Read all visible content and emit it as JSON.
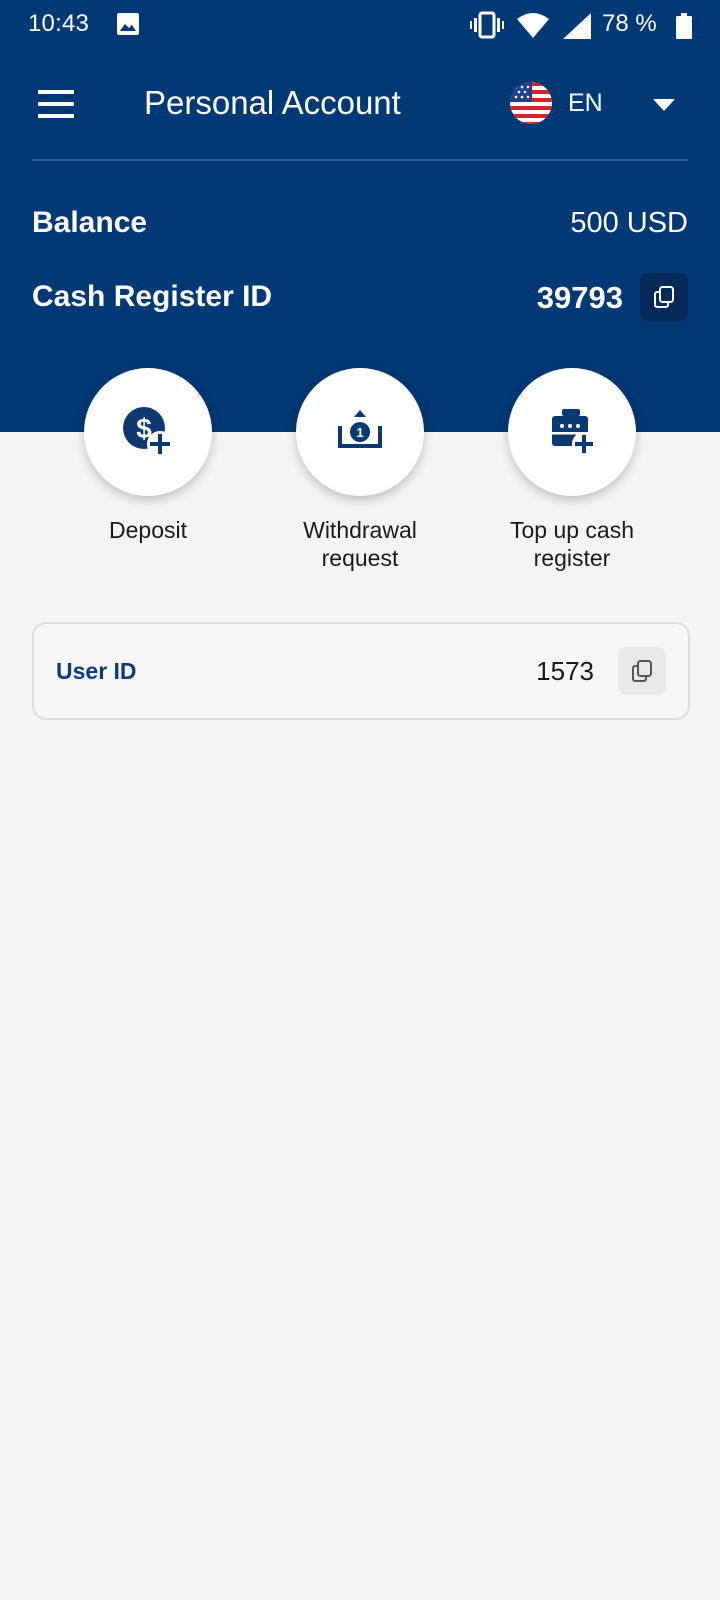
{
  "status_bar": {
    "time": "10:43",
    "battery": "78 %",
    "icons": [
      "gallery-icon",
      "vibrate-icon",
      "wifi-icon",
      "signal-icon",
      "battery-icon"
    ]
  },
  "app_bar": {
    "title": "Personal Account",
    "menu_icon": "hamburger-menu-icon",
    "language": {
      "code": "EN",
      "flag_icon": "us-flag-icon",
      "dropdown_icon": "chevron-down-icon"
    }
  },
  "account": {
    "balance_label": "Balance",
    "balance_value": "500 USD",
    "cash_register_label": "Cash Register ID",
    "cash_register_value": "39793",
    "copy_icon": "copy-icon"
  },
  "actions": [
    {
      "label": "Deposit",
      "icon": "dollar-plus-icon"
    },
    {
      "label": "Withdrawal request",
      "icon": "withdraw-tray-icon"
    },
    {
      "label": "Top up cash register",
      "icon": "cash-register-plus-icon"
    }
  ],
  "user": {
    "label": "User ID",
    "value": "1573",
    "copy_icon": "copy-icon"
  },
  "colors": {
    "header_bg": "#003976",
    "page_bg": "#f4f4f4",
    "accent_text": "#0d3c7a",
    "copy_button_dark": "#062a57",
    "icon_fill": "#0b3a73"
  }
}
